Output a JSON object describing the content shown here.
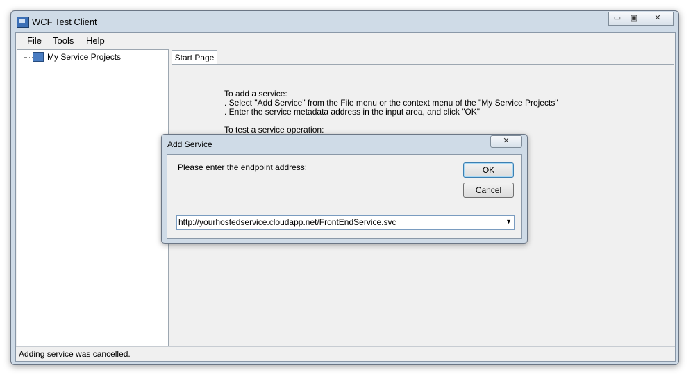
{
  "window": {
    "title": "WCF Test Client",
    "controls": {
      "minimize": "▭",
      "restore": "▣",
      "close": "✕"
    }
  },
  "menu": {
    "file": "File",
    "tools": "Tools",
    "help": "Help"
  },
  "tree": {
    "root_label": "My Service Projects"
  },
  "tabs": {
    "start_page": "Start Page"
  },
  "start_page": {
    "line1": "To add a service:",
    "line2": ". Select \"Add Service\" from the File menu or the context menu of the \"My Service Projects\"",
    "line3": ". Enter the service metadata address in the input area, and click \"OK\"",
    "line4": "To test a service operation:"
  },
  "status": {
    "text": "Adding service was cancelled."
  },
  "dialog": {
    "title": "Add Service",
    "close": "✕",
    "prompt": "Please enter the endpoint address:",
    "ok": "OK",
    "cancel": "Cancel",
    "endpoint_value": "http://yourhostedservice.cloudapp.net/FrontEndService.svc",
    "dropdown_arrow": "▼"
  },
  "colors": {
    "chrome": "#cfdbe7",
    "client": "#f0f0f0",
    "accent": "#3c7fb1"
  }
}
